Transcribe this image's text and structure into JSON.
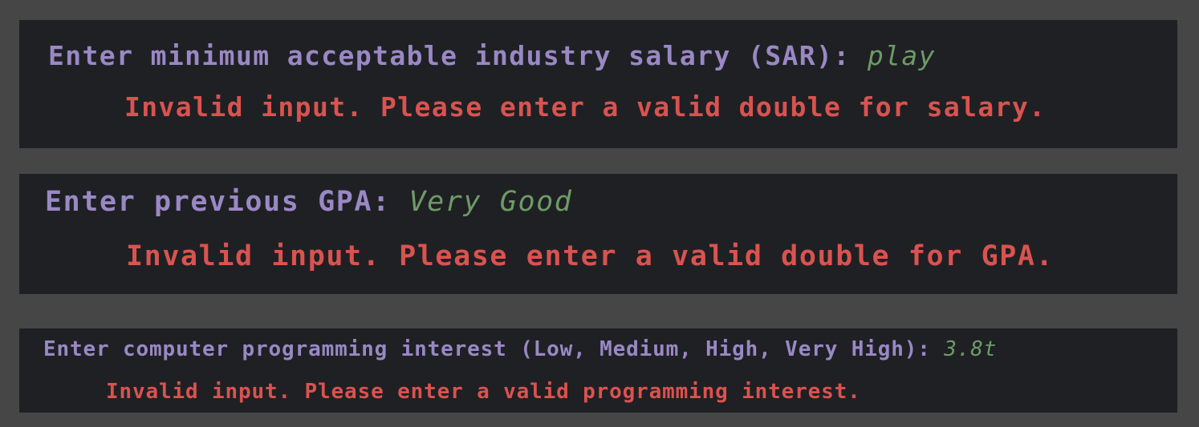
{
  "console": {
    "entries": [
      {
        "prompt": "Enter minimum acceptable industry salary (SAR): ",
        "input": "play",
        "error": "Invalid input. Please enter a valid double for salary."
      },
      {
        "prompt": "Enter previous GPA: ",
        "input": "Very Good",
        "error": "Invalid input. Please enter a valid double for GPA."
      },
      {
        "prompt": "Enter computer programming interest (Low, Medium, High, Very High): ",
        "input": "3.8t",
        "error": "Invalid input. Please enter a valid programming interest."
      }
    ]
  },
  "colors": {
    "background": "#464646",
    "panel": "#1f2024",
    "prompt": "#9a88c4",
    "input": "#6e9b66",
    "error": "#d9534f"
  }
}
